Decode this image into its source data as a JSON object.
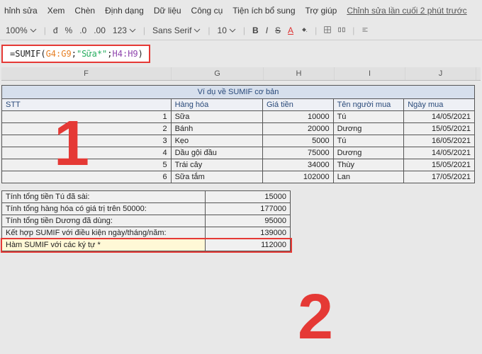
{
  "menu": {
    "items": [
      "hỉnh sửa",
      "Xem",
      "Chèn",
      "Định dạng",
      "Dữ liệu",
      "Công cụ",
      "Tiện ích bổ sung",
      "Trợ giúp"
    ],
    "edit_status": "Chỉnh sửa lần cuối 2 phút trước"
  },
  "toolbar": {
    "zoom": "100%",
    "currency": "đ",
    "percent": "%",
    "dec_down": ".0",
    "dec_up": ".00",
    "num_format": "123",
    "font": "Sans Serif",
    "font_size": "10",
    "bold": "B",
    "italic": "I",
    "strike": "S",
    "color": "A"
  },
  "formula": {
    "prefix": "=SUMIF(",
    "range1": "G4:G9",
    "sep1": ";",
    "str": "\"Sữa*\"",
    "sep2": ";",
    "range2": "H4:H9",
    "suffix": ")"
  },
  "columns": [
    "F",
    "G",
    "H",
    "I",
    "J"
  ],
  "table": {
    "title": "Ví dụ về SUMIF cơ bản",
    "headers": [
      "STT",
      "Hàng hóa",
      "Giá tiền",
      "Tên người mua",
      "Ngày mua"
    ],
    "rows": [
      {
        "stt": "1",
        "hang": "Sữa",
        "gia": "10000",
        "ten": "Tú",
        "ngay": "14/05/2021"
      },
      {
        "stt": "2",
        "hang": "Bánh",
        "gia": "20000",
        "ten": "Dương",
        "ngay": "15/05/2021"
      },
      {
        "stt": "3",
        "hang": "Kẹo",
        "gia": "5000",
        "ten": "Tú",
        "ngay": "16/05/2021"
      },
      {
        "stt": "4",
        "hang": "Dầu gội đầu",
        "gia": "75000",
        "ten": "Dương",
        "ngay": "14/05/2021"
      },
      {
        "stt": "5",
        "hang": "Trái cây",
        "gia": "34000",
        "ten": "Thùy",
        "ngay": "15/05/2021"
      },
      {
        "stt": "6",
        "hang": "Sữa tắm",
        "gia": "102000",
        "ten": "Lan",
        "ngay": "17/05/2021"
      }
    ]
  },
  "summary": {
    "rows": [
      {
        "label": "Tính tổng tiền Tú đã sài:",
        "val": "15000"
      },
      {
        "label": "Tính tổng hàng hóa có giá trị trên 50000:",
        "val": "177000"
      },
      {
        "label": "Tính tổng tiền Dương đã dùng:",
        "val": "95000"
      },
      {
        "label": "Kết hợp SUMIF với điều kiện ngày/tháng/năm:",
        "val": "139000"
      },
      {
        "label": "Hàm SUMIF với các ký tự *",
        "val": "112000"
      }
    ]
  },
  "callouts": {
    "one": "1",
    "two": "2"
  }
}
